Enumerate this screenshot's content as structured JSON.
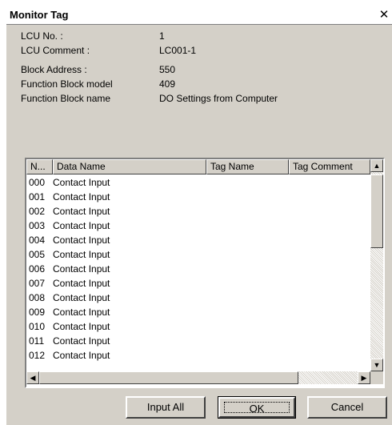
{
  "window": {
    "title": "Monitor Tag",
    "close_glyph": "✕"
  },
  "info": {
    "lcu_no_label": "LCU No. :",
    "lcu_no_value": "1",
    "lcu_comment_label": "LCU Comment :",
    "lcu_comment_value": "LC001-1",
    "block_address_label": "Block Address :",
    "block_address_value": "550",
    "fb_model_label": "Function Block model",
    "fb_model_value": "409",
    "fb_name_label": "Function Block name",
    "fb_name_value": "DO Settings from Computer"
  },
  "table": {
    "columns": [
      "N...",
      "Data Name",
      "Tag Name",
      "Tag Comment"
    ],
    "rows": [
      {
        "num": "000",
        "data_name": "Contact Input"
      },
      {
        "num": "001",
        "data_name": "Contact Input"
      },
      {
        "num": "002",
        "data_name": "Contact Input"
      },
      {
        "num": "003",
        "data_name": "Contact Input"
      },
      {
        "num": "004",
        "data_name": "Contact Input"
      },
      {
        "num": "005",
        "data_name": "Contact Input"
      },
      {
        "num": "006",
        "data_name": "Contact Input"
      },
      {
        "num": "007",
        "data_name": "Contact Input"
      },
      {
        "num": "008",
        "data_name": "Contact Input"
      },
      {
        "num": "009",
        "data_name": "Contact Input"
      },
      {
        "num": "010",
        "data_name": "Contact Input"
      },
      {
        "num": "011",
        "data_name": "Contact Input"
      },
      {
        "num": "012",
        "data_name": "Contact Input"
      }
    ]
  },
  "scrollbar": {
    "up_icon": "▲",
    "down_icon": "▼",
    "left_icon": "◀",
    "right_icon": "▶"
  },
  "buttons": {
    "input_all": "Input All",
    "ok": "OK",
    "cancel": "Cancel"
  }
}
